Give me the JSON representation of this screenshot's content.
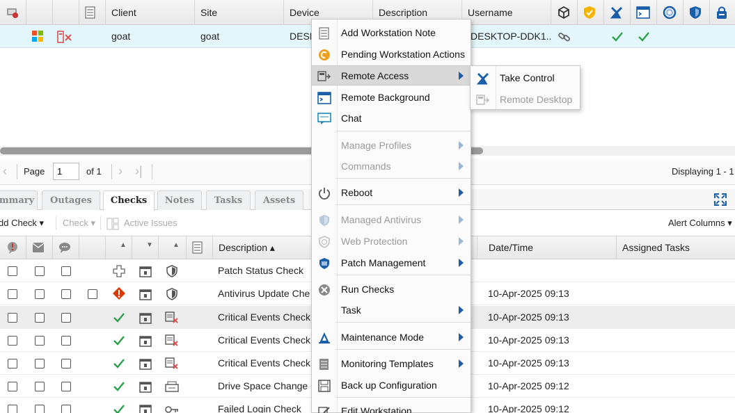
{
  "top_grid": {
    "headers": [
      "Client",
      "Site",
      "Device",
      "Description",
      "Username"
    ],
    "row": {
      "client": "goat",
      "site": "goat",
      "device": "DESK",
      "username": "DESKTOP-DDK1..."
    }
  },
  "pager": {
    "page_label": "Page",
    "page_value": "1",
    "of_label": "of 1",
    "displaying": "Displaying 1 - 1"
  },
  "tabs": [
    "mmary",
    "Outages",
    "Checks",
    "Notes",
    "Tasks",
    "Assets"
  ],
  "active_tab": "Checks",
  "toolbar": {
    "add_check": "dd Check ▾",
    "check": "Check ▾",
    "active_issues": "Active Issues",
    "alert_columns": "Alert Columns ▾"
  },
  "checks_grid": {
    "headers": {
      "description": "Description ▴",
      "datetime": "Date/Time",
      "assigned_tasks": "Assigned Tasks"
    },
    "rows": [
      {
        "description": "Patch Status Check",
        "datetime": ""
      },
      {
        "description": "Antivirus Update Che",
        "datetime": "10-Apr-2025 09:13"
      },
      {
        "description": "Critical Events Check",
        "datetime": "10-Apr-2025 09:13"
      },
      {
        "description": "Critical Events Check",
        "datetime": "10-Apr-2025 09:13"
      },
      {
        "description": "Critical Events Check",
        "datetime": "10-Apr-2025 09:13"
      },
      {
        "description": "Drive Space Change C",
        "datetime": "10-Apr-2025 09:12"
      },
      {
        "description": "Failed Login Check",
        "datetime": "10-Apr-2025 09:12"
      }
    ]
  },
  "context_menu": {
    "items": [
      {
        "label": "Add Workstation Note",
        "icon": "note-icon"
      },
      {
        "label": "Pending Workstation Actions",
        "icon": "pending-icon"
      },
      {
        "label": "Remote Access",
        "icon": "remote-access-icon"
      },
      {
        "label": "Remote Background",
        "icon": "terminal-icon"
      },
      {
        "label": "Chat",
        "icon": "chat-icon"
      },
      {
        "label": "Manage Profiles",
        "icon": ""
      },
      {
        "label": "Commands",
        "icon": ""
      },
      {
        "label": "Reboot",
        "icon": "power-icon"
      },
      {
        "label": "Managed Antivirus",
        "icon": "shield-icon"
      },
      {
        "label": "Web Protection",
        "icon": "web-shield-icon"
      },
      {
        "label": "Patch Management",
        "icon": "patch-shield-icon"
      },
      {
        "label": "Run Checks",
        "icon": "run-checks-icon"
      },
      {
        "label": "Task",
        "icon": ""
      },
      {
        "label": "Maintenance Mode",
        "icon": "maintenance-icon"
      },
      {
        "label": "Monitoring Templates",
        "icon": "template-icon"
      },
      {
        "label": "Back up Configuration",
        "icon": "save-icon"
      },
      {
        "label": "Edit Workstation",
        "icon": "edit-icon"
      }
    ]
  },
  "submenu": {
    "take_control": "Take Control",
    "remote_desktop": "Remote Desktop"
  },
  "colors": {
    "selected_row": "#e3f6fb",
    "accent_blue": "#1a5ea8",
    "check_green": "#2aa04a",
    "error_red": "#d83b01",
    "shield_orange": "#f5b400"
  }
}
